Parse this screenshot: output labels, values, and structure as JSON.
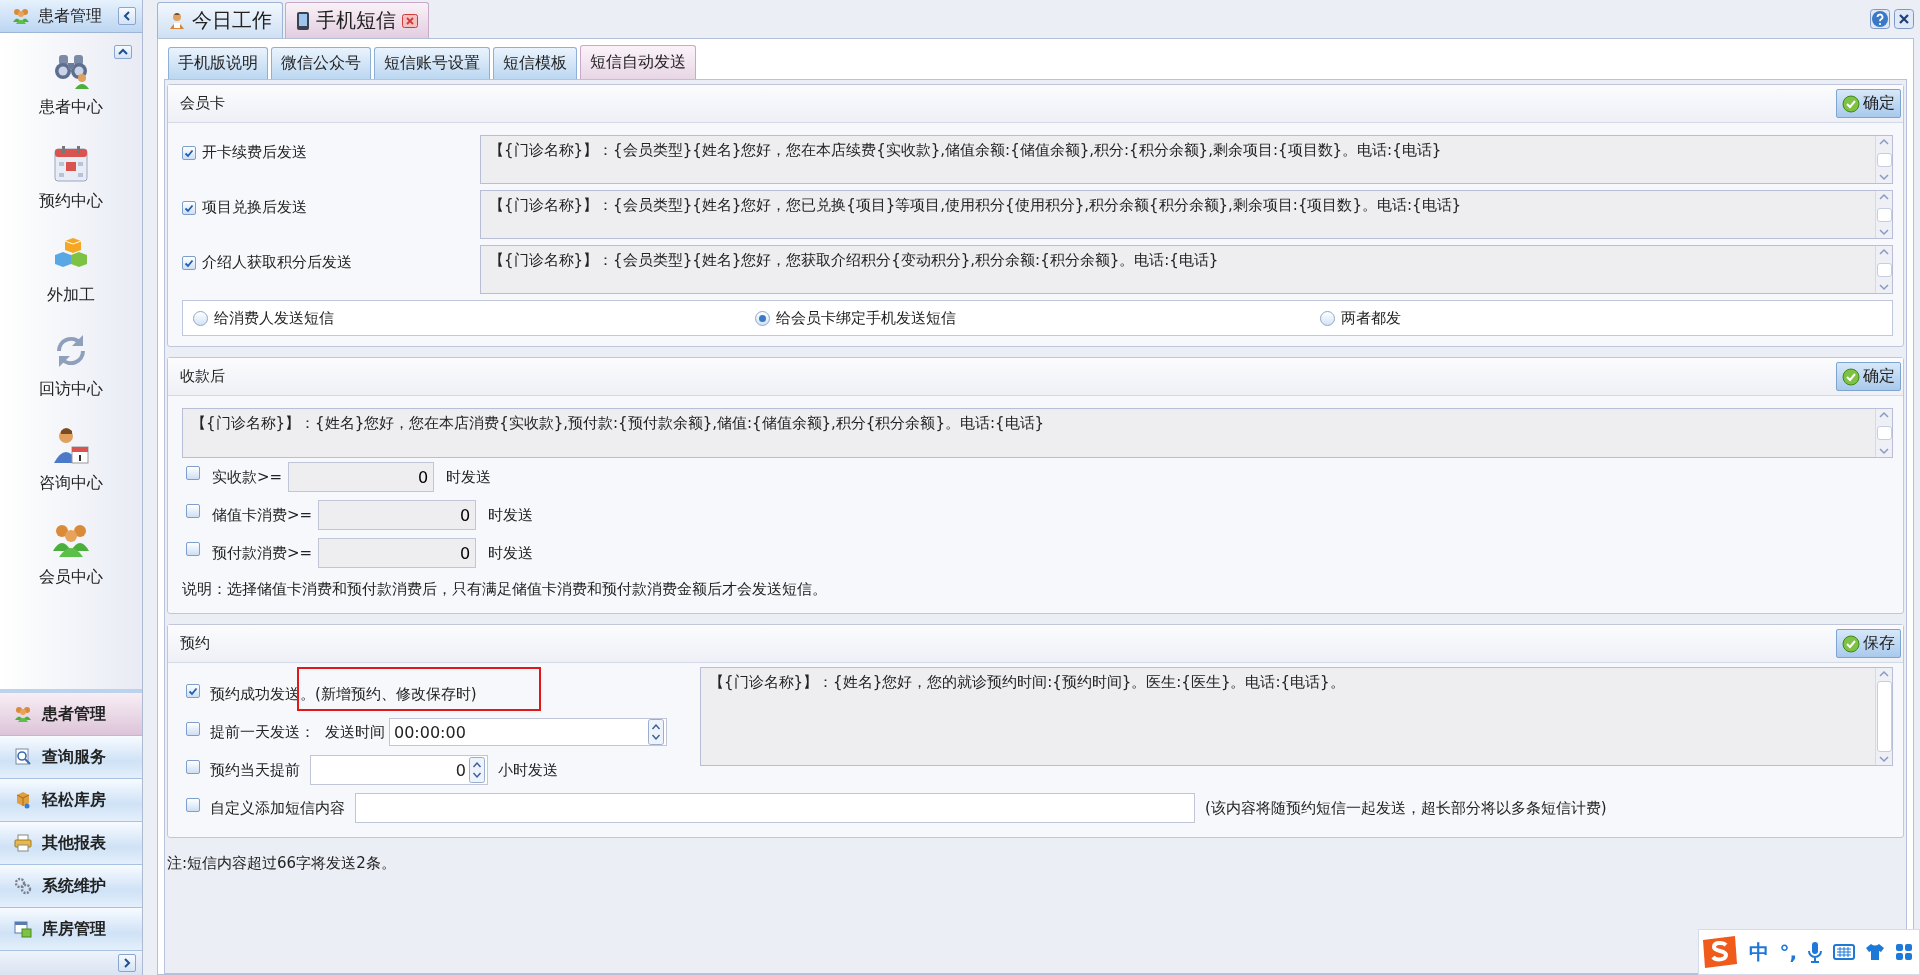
{
  "sidebar": {
    "title": "患者管理",
    "items": [
      {
        "label": "患者中心"
      },
      {
        "label": "预约中心"
      },
      {
        "label": "外加工"
      },
      {
        "label": "回访中心"
      },
      {
        "label": "咨询中心"
      },
      {
        "label": "会员中心"
      }
    ],
    "nav": [
      {
        "label": "患者管理",
        "selected": true
      },
      {
        "label": "查询服务",
        "selected": false
      },
      {
        "label": "轻松库房",
        "selected": false
      },
      {
        "label": "其他报表",
        "selected": false
      },
      {
        "label": "系统维护",
        "selected": false
      },
      {
        "label": "库房管理",
        "selected": false
      }
    ]
  },
  "window_tabs": [
    {
      "label": "今日工作",
      "selected": false,
      "closable": false
    },
    {
      "label": "手机短信",
      "selected": true,
      "closable": true
    }
  ],
  "sub_tabs": [
    {
      "label": "手机版说明",
      "selected": false
    },
    {
      "label": "微信公众号",
      "selected": false
    },
    {
      "label": "短信账号设置",
      "selected": false
    },
    {
      "label": "短信模板",
      "selected": false
    },
    {
      "label": "短信自动发送",
      "selected": true
    }
  ],
  "member_card": {
    "title": "会员卡",
    "button": "确定",
    "rows": [
      {
        "label": "开卡续费后发送",
        "checked": true,
        "message": "【{门诊名称}】：{会员类型}{姓名}您好，您在本店续费{实收款},储值余额:{储值余额},积分:{积分余额},剩余项目:{项目数}。电话:{电话}"
      },
      {
        "label": "项目兑换后发送",
        "checked": true,
        "message": "【{门诊名称}】：{会员类型}{姓名}您好，您已兑换{项目}等项目,使用积分{使用积分},积分余额{积分余额},剩余项目:{项目数}。电话:{电话}"
      },
      {
        "label": "介绍人获取积分后发送",
        "checked": true,
        "message": "【{门诊名称}】：{会员类型}{姓名}您好，您获取介绍积分{变动积分},积分余额:{积分余额}。电话:{电话}"
      }
    ],
    "recipients": [
      {
        "label": "给消费人发送短信",
        "selected": false
      },
      {
        "label": "给会员卡绑定手机发送短信",
        "selected": true
      },
      {
        "label": "两者都发",
        "selected": false
      }
    ]
  },
  "payment": {
    "title": "收款后",
    "button": "确定",
    "message": "【{门诊名称}】：{姓名}您好，您在本店消费{实收款},预付款:{预付款余额},储值:{储值余额},积分{积分余额}。电话:{电话}",
    "thresholds": [
      {
        "label": "实收款>=",
        "value": "0",
        "suffix": "时发送",
        "checked": false
      },
      {
        "label": "储值卡消费>=",
        "value": "0",
        "suffix": "时发送",
        "checked": false
      },
      {
        "label": "预付款消费>=",
        "value": "0",
        "suffix": "时发送",
        "checked": false
      }
    ],
    "note": "说明：选择储值卡消费和预付款消费后，只有满足储值卡消费和预付款消费金额后才会发送短信。"
  },
  "appointment": {
    "title": "预约",
    "button": "保存",
    "options": [
      {
        "kind": "check",
        "label": "预约成功发送。(新增预约、修改保存时)",
        "checked": true
      },
      {
        "kind": "time",
        "label": "提前一天发送：",
        "field_label": "发送时间",
        "value": "00:00:00",
        "checked": false
      },
      {
        "kind": "hours",
        "label": "预约当天提前",
        "value": "0",
        "suffix": "小时发送",
        "checked": false
      }
    ],
    "message": "【{门诊名称}】：{姓名}您好，您的就诊预约时间:{预约时间}。医生:{医生}。电话:{电话}。",
    "custom": {
      "label": "自定义添加短信内容",
      "checked": false,
      "hint": "(该内容将随预约短信一起发送，超长部分将以多条短信计费)"
    }
  },
  "footer_note": "注:短信内容超过66字将发送2条。",
  "ime": {
    "mode": "中",
    "punctuation": "°,"
  }
}
